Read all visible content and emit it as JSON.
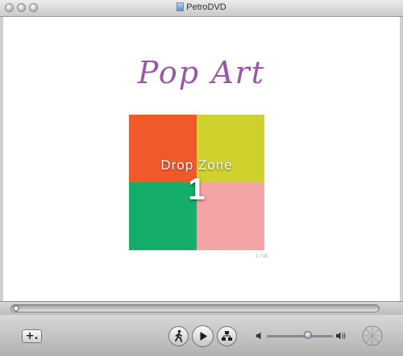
{
  "window": {
    "title": "PetroDVD"
  },
  "menu": {
    "heading": "Pop Art",
    "drop_zone_label": "Drop Zone",
    "drop_zone_number": "1",
    "caption": "1 / 08",
    "colors": {
      "top_left": "#f05a2b",
      "top_right": "#cfd22d",
      "bottom_left": "#14ae6a",
      "bottom_right": "#f4a4a4",
      "heading": "#9a57a7"
    }
  },
  "controls": {
    "add_label": "+.",
    "volume_level": 0.62
  },
  "icons": [
    "close-icon",
    "minimize-icon",
    "zoom-icon",
    "document-icon",
    "walk-icon",
    "play-icon",
    "chapter-icon",
    "volume-low-icon",
    "volume-high-icon",
    "resize-icon",
    "playhead-icon"
  ]
}
